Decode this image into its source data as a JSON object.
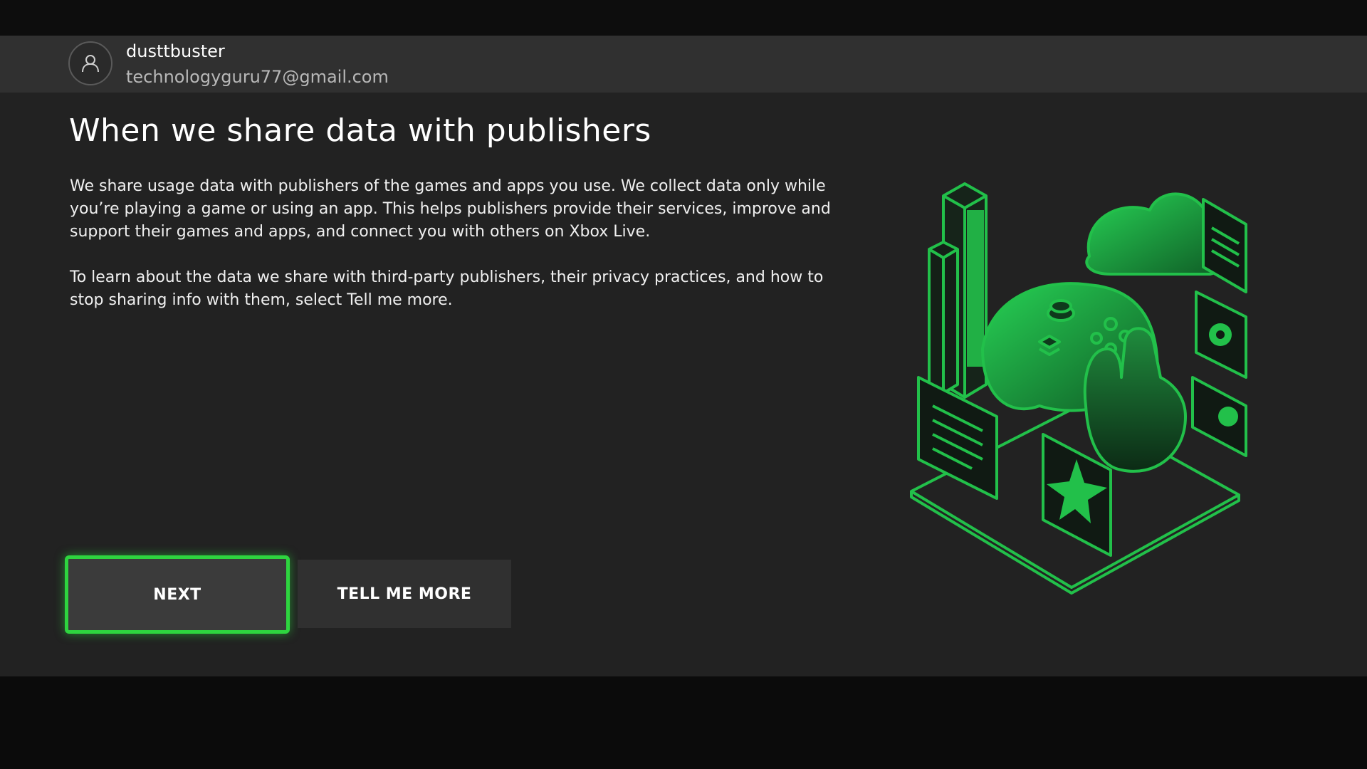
{
  "account": {
    "gamertag": "dusttbuster",
    "email": "technologyguru77@gmail.com",
    "avatar_icon": "person-icon"
  },
  "page": {
    "title": "When we share data with publishers",
    "paragraph_1": "We share usage data with publishers of the games and apps you use. We collect data only while you’re playing a game or using an app. This helps publishers provide their services, improve and support their games and apps, and connect you with others on Xbox Live.",
    "paragraph_2": "To learn about the data we share with third-party publishers, their privacy practices, and how to stop sharing info with them, select Tell me more."
  },
  "buttons": {
    "next_label": "NEXT",
    "tell_more_label": "TELL ME MORE"
  },
  "colors": {
    "accent": "#2ed43f",
    "illustration_green": "#22c04a",
    "background": "#222222",
    "account_bar": "#303030"
  }
}
